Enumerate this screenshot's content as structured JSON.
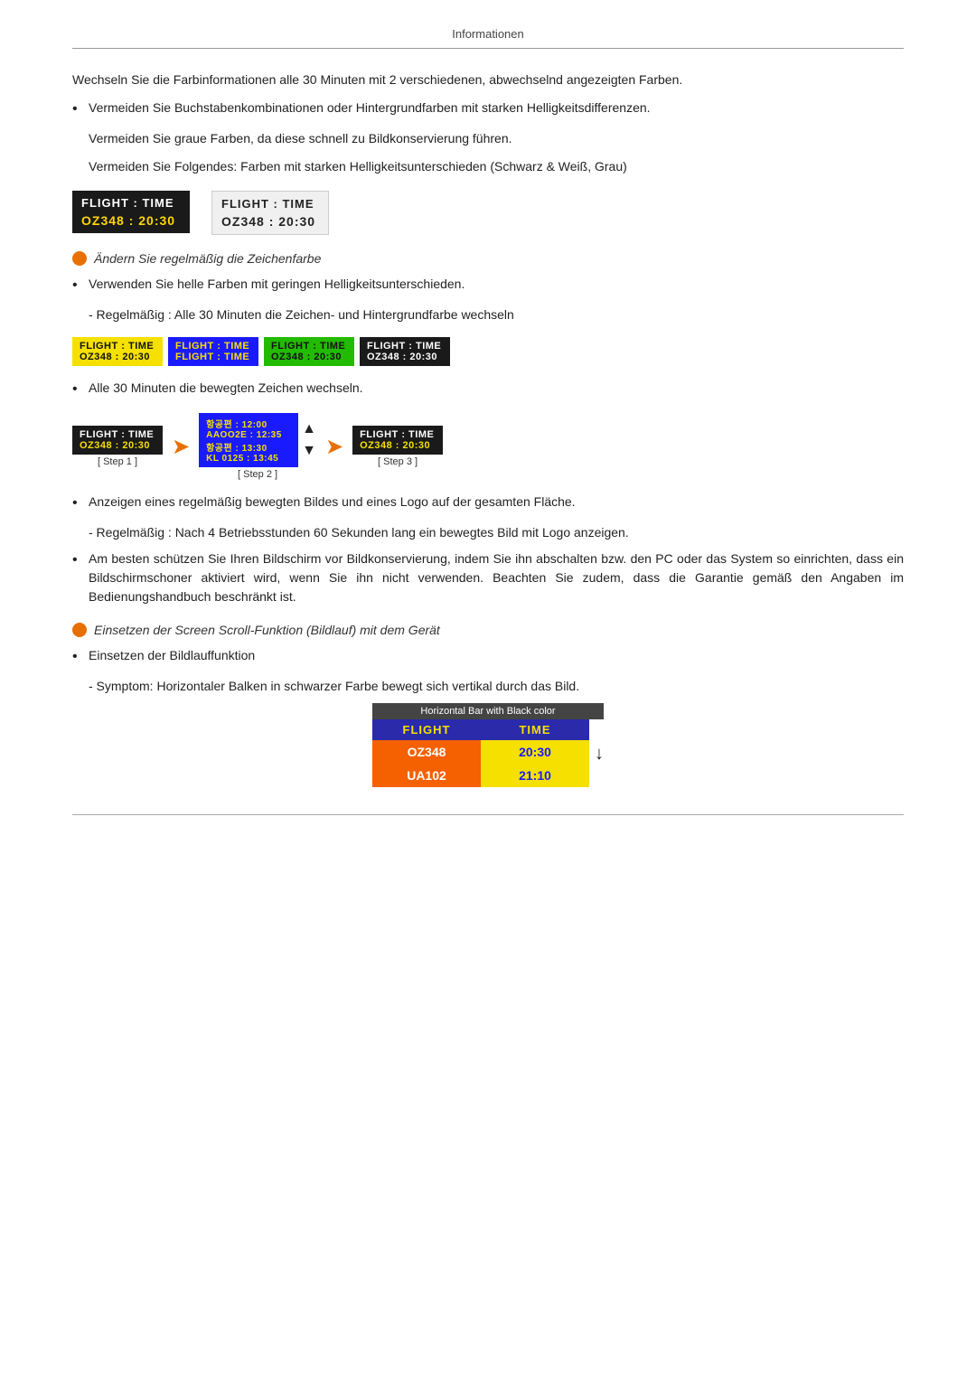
{
  "header": {
    "title": "Informationen"
  },
  "paragraphs": {
    "p1": "Wechseln Sie die Farbinformationen alle 30 Minuten mit 2 verschiedenen, ab­wechselnd angezeigten Farben.",
    "b1": "Vermeiden Sie Buchstabenkombinationen oder Hintergrundfarben mit starken Helligkeitsdifferenzen.",
    "b2": "Vermeiden Sie graue Farben, da diese schnell zu Bildkonservierung führen.",
    "b3": "Vermeiden Sie Folgendes: Farben mit starken Helligkeitsunterschieden (Schwarz & Weiß, Grau)",
    "section1": "Ändern Sie regelmäßig die Zeichenfarbe",
    "b4": "Verwenden Sie helle Farben mit geringen Helligkeitsunterschieden.",
    "sub1": "- Regelmäßig : Alle 30 Minuten die Zeichen- und Hintergrundfarbe wechseln",
    "b5": "Alle 30 Minuten die bewegten Zeichen wechseln.",
    "b6": "Anzeigen eines regelmäßig bewegten Bildes und eines Logo auf der gesamten Fläche.",
    "sub2": "- Regelmäßig : Nach 4 Betriebsstunden 60 Sekunden lang ein bewegtes Bild mit Logo anzeigen.",
    "b7": "Am besten schützen Sie Ihren Bildschirm vor Bildkonservierung, indem Sie ihn abschalten bzw. den PC oder das System so einrichten, dass ein Bild­schirmschoner aktiviert wird, wenn Sie ihn nicht verwenden. Beachten Sie zudem, dass die Garantie gemäß den Angaben im Bedienungshandbuch beschränkt ist.",
    "section2": "Einsetzen der Screen Scroll-Funktion (Bildlauf) mit dem Gerät",
    "b8": "Einsetzen der Bildlauffunktion",
    "sub3": "- Symptom: Horizontaler Balken in schwarzer Farbe bewegt sich vertikal durch das Bild."
  },
  "flight_dark": {
    "row1": "FLIGHT  :  TIME",
    "row2": "OZ348   :  20:30"
  },
  "flight_light": {
    "row1": "FLIGHT  :  TIME",
    "row2": "OZ348   :  20:30"
  },
  "color_boxes": [
    {
      "row1": "FLIGHT  :  TIME",
      "row2": "OZ348  :  20:30",
      "bg": "#f5e000",
      "fg": "#111",
      "row2fg": "#111"
    },
    {
      "row1": "FLIGHT  :  TIME",
      "row2": "FLIGHT  :  TIME",
      "bg": "#1a1aff",
      "fg": "#f5e000",
      "row2fg": "#f5e000"
    },
    {
      "row1": "FLIGHT  :  TIME",
      "row2": "OZ348  :  20:30",
      "bg": "#22bb00",
      "fg": "#111",
      "row2fg": "#111"
    },
    {
      "row1": "FLIGHT  :  TIME",
      "row2": "OZ348   :  20:30",
      "bg": "#1a1a1a",
      "fg": "#fff",
      "row2fg": "#fff"
    }
  ],
  "step1": {
    "row1": "FLIGHT  :  TIME",
    "row2": "OZ348  :  20:30",
    "bg": "#1a1a1a",
    "fg": "#fff",
    "row2fg": "#f5e000",
    "label": "[ Step 1 ]"
  },
  "step2": {
    "row1": "항공편 :  12:00",
    "row2": "AAOO2E : 12:35",
    "row3": "항공편 :  13:30",
    "row4": "KL 0125 : 13:45",
    "bg": "#1a1aff",
    "fg": "#f5e000",
    "label": "[ Step 2 ]"
  },
  "step3": {
    "row1": "FLIGHT  :  TIME",
    "row2": "OZ348   :  20:30",
    "bg": "#1a1a1a",
    "fg": "#fff",
    "row2fg": "#f5e000",
    "label": "[ Step 3 ]"
  },
  "hbar": {
    "title": "Horizontal Bar with Black color",
    "header": [
      "FLIGHT",
      "TIME"
    ],
    "rows": [
      {
        "col1": "OZ348",
        "col2": "20:30"
      },
      {
        "col1": "UA102",
        "col2": "21:10"
      }
    ]
  }
}
